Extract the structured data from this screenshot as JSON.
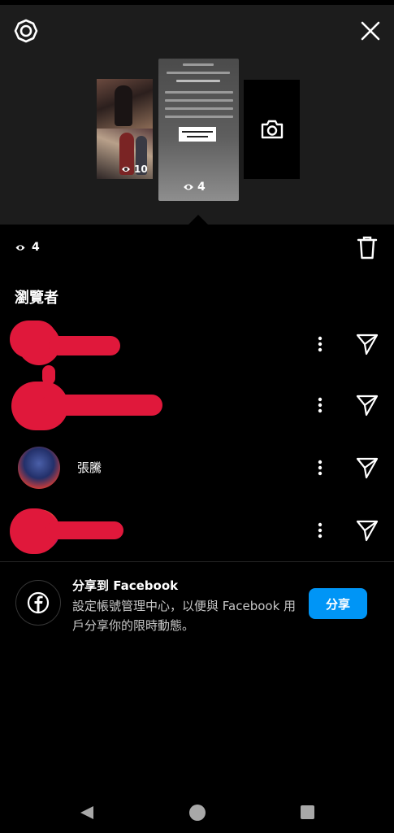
{
  "story_preview": {
    "left_thumb_views": "10",
    "center_thumb_views": "4"
  },
  "views": {
    "count": "4"
  },
  "viewers_section": {
    "title": "瀏覽者",
    "viewers": [
      {
        "name": ""
      },
      {
        "name": ""
      },
      {
        "name": "張騰"
      },
      {
        "name": ""
      }
    ]
  },
  "facebook_share": {
    "title": "分享到 Facebook",
    "description": "設定帳號管理中心，以便與 Facebook 用戶分享你的限時動態。",
    "button_label": "分享"
  },
  "colors": {
    "accent": "#0095f6",
    "background": "#000000",
    "panel": "#1c1c1c",
    "redaction": "#e0183b"
  },
  "icons": [
    "settings-icon",
    "close-icon",
    "camera-icon",
    "eye-icon",
    "trash-icon",
    "more-vertical-icon",
    "send-icon",
    "facebook-icon",
    "nav-back-icon",
    "nav-home-icon",
    "nav-recents-icon"
  ]
}
